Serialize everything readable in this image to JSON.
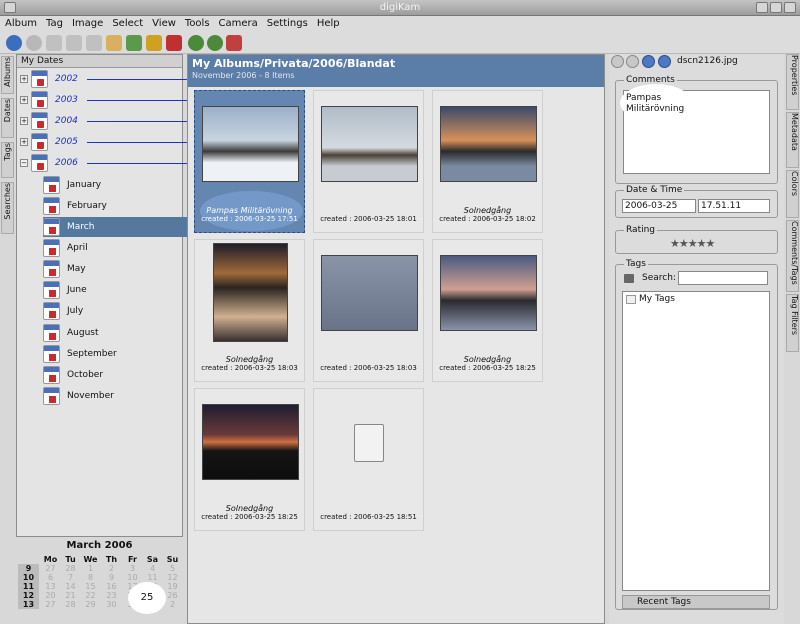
{
  "window": {
    "title": "digiKam"
  },
  "menu": [
    "Album",
    "Tag",
    "Image",
    "Select",
    "View",
    "Tools",
    "Camera",
    "Settings",
    "Help"
  ],
  "left_tabs": [
    "Albums",
    "Dates",
    "Tags",
    "Searches"
  ],
  "tree": {
    "header": "My Dates",
    "years": [
      "2002",
      "2003",
      "2004",
      "2005",
      "2006"
    ],
    "months": [
      "January",
      "February",
      "March",
      "April",
      "May",
      "June",
      "July",
      "August",
      "September",
      "October",
      "November"
    ],
    "selected_month": "March"
  },
  "date_nav": {
    "title": "March 2006",
    "days": [
      "Mo",
      "Tu",
      "We",
      "Th",
      "Fr",
      "Sa",
      "Su"
    ],
    "weeks": [
      {
        "wk": "9",
        "d": [
          "27",
          "28",
          "1",
          "2",
          "3",
          "4",
          "5"
        ]
      },
      {
        "wk": "10",
        "d": [
          "6",
          "7",
          "8",
          "9",
          "10",
          "11",
          "12"
        ]
      },
      {
        "wk": "11",
        "d": [
          "13",
          "14",
          "15",
          "16",
          "17",
          "18",
          "19"
        ]
      },
      {
        "wk": "12",
        "d": [
          "20",
          "21",
          "22",
          "23",
          "24",
          "25",
          "26"
        ]
      },
      {
        "wk": "13",
        "d": [
          "27",
          "28",
          "29",
          "30",
          "31",
          "1",
          "2"
        ]
      }
    ],
    "highlight": "25"
  },
  "album": {
    "path": "My Albums/Privata/2006/Blandat",
    "info": "November 2006 - 8 Items"
  },
  "items": [
    {
      "caption": "Pampas Militärövning",
      "created": "created : 2006-03-25 17:51"
    },
    {
      "caption": "",
      "created": "created : 2006-03-25 18:01"
    },
    {
      "caption": "Solnedgång",
      "created": "created : 2006-03-25 18:02"
    },
    {
      "caption": "Solnedgång",
      "created": "created : 2006-03-25 18:03"
    },
    {
      "caption": "",
      "created": "created : 2006-03-25 18:03"
    },
    {
      "caption": "Solnedgång",
      "created": "created : 2006-03-25 18:25"
    },
    {
      "caption": "Solnedgång",
      "created": "created : 2006-03-25 18:25"
    },
    {
      "caption": "",
      "created": "created : 2006-03-25 18:51"
    }
  ],
  "right": {
    "filename": "dscn2126.jpg",
    "comments_label": "Comments",
    "comments_text_1": "Pampas",
    "comments_text_2": "Militärövning",
    "datetime_label": "Date & Time",
    "date": "2006-03-25",
    "time": "17.51.11",
    "rating_label": "Rating",
    "rating_stars": "★★★★★",
    "tags_label": "Tags",
    "search_label": "Search:",
    "my_tags": "My Tags",
    "recent_tags": "Recent Tags"
  },
  "right_tabs": [
    "Properties",
    "Metadata",
    "Colors",
    "Comments/Tags",
    "Tag Filters"
  ]
}
